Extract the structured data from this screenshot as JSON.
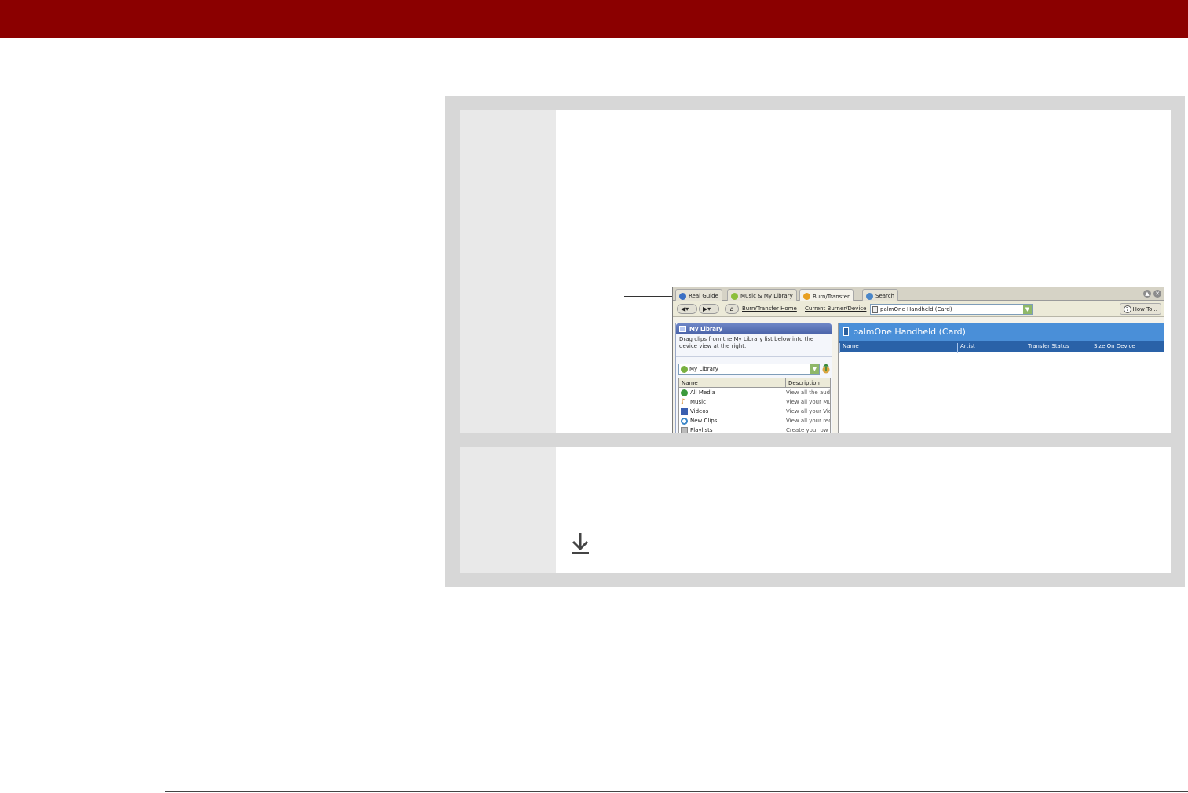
{
  "screenshot": {
    "tabs": [
      {
        "label": "Real Guide",
        "icon": "real-guide-icon",
        "color": "#3a6fc4"
      },
      {
        "label": "Music & My Library",
        "icon": "music-library-icon",
        "color": "#8cbf3a"
      },
      {
        "label": "Burn/Transfer",
        "icon": "burn-transfer-icon",
        "color": "#e8a020"
      },
      {
        "label": "Search",
        "icon": "search-icon",
        "color": "#4a86c8"
      }
    ],
    "toolbar": {
      "home_link": "Burn/Transfer Home",
      "current_device_link": "Current Burner/Device",
      "device_value": "palmOne Handheld (Card)",
      "howto_label": "How To..."
    },
    "library": {
      "title": "My Library",
      "instructions": "Drag clips from the My Library list below into the device view at the right.",
      "select_value": "My Library",
      "columns": [
        "Name",
        "Description"
      ],
      "rows": [
        {
          "name": "All Media",
          "description": "View all the aud",
          "icon": "all-media-icon",
          "color": "#3c9a3c"
        },
        {
          "name": "Music",
          "description": "View all your Mu",
          "icon": "music-note-icon",
          "color": "#d08020"
        },
        {
          "name": "Videos",
          "description": "View all your Vid",
          "icon": "video-icon",
          "color": "#3a5fb0"
        },
        {
          "name": "New Clips",
          "description": "View all your rec",
          "icon": "new-clips-icon",
          "color": "#3a86c8"
        },
        {
          "name": "Playlists",
          "description": "Create your ow",
          "icon": "playlist-icon",
          "color": "#888888"
        }
      ]
    },
    "device_pane": {
      "title": "palmOne Handheld (Card)",
      "columns": [
        "Name",
        "Artist",
        "Transfer Status",
        "Size On Device"
      ]
    }
  },
  "colors": {
    "header_bar": "#8b0000",
    "panel_bg": "#d7d7d7",
    "step_number_bg": "#e9e9e9"
  }
}
